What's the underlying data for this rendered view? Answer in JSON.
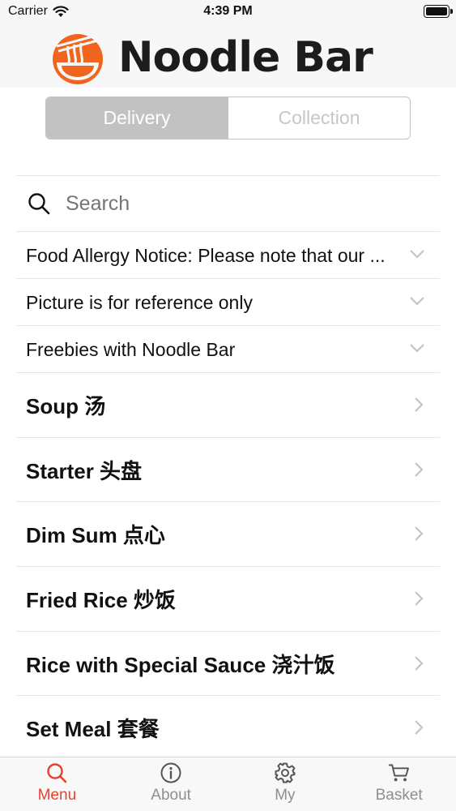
{
  "status_bar": {
    "carrier": "Carrier",
    "time": "4:39 PM"
  },
  "header": {
    "logo_text": "Noodle Bar"
  },
  "order_mode": {
    "options": [
      "Delivery",
      "Collection"
    ],
    "selected": "Delivery"
  },
  "search": {
    "placeholder": "Search"
  },
  "notices": [
    {
      "label": "Food Allergy Notice: Please note that our ..."
    },
    {
      "label": "Picture is for reference only"
    },
    {
      "label": "Freebies with Noodle Bar"
    }
  ],
  "categories": [
    {
      "label": "Soup 汤"
    },
    {
      "label": "Starter 头盘"
    },
    {
      "label": "Dim Sum 点心"
    },
    {
      "label": "Fried Rice 炒饭"
    },
    {
      "label": "Rice with Special Sauce 浇汁饭"
    },
    {
      "label": "Set Meal 套餐"
    }
  ],
  "tab_bar": {
    "items": [
      {
        "label": "Menu",
        "icon": "search-icon",
        "active": true
      },
      {
        "label": "About",
        "icon": "info-icon",
        "active": false
      },
      {
        "label": "My",
        "icon": "gear-icon",
        "active": false
      },
      {
        "label": "Basket",
        "icon": "cart-icon",
        "active": false
      }
    ]
  },
  "colors": {
    "accent": "#e8412f",
    "logo_orange": "#f0641e",
    "segment_selected": "#c2c2c3"
  }
}
